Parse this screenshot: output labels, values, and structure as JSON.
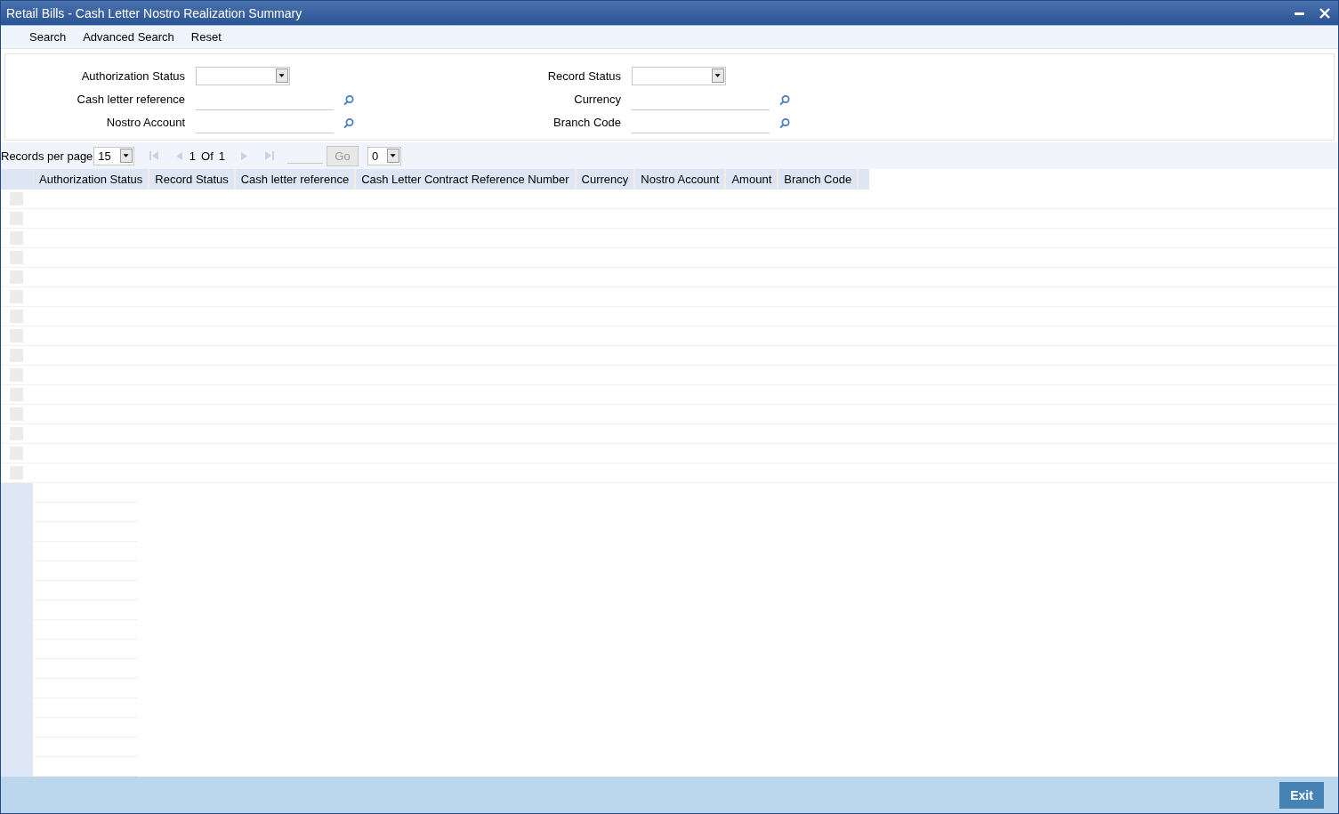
{
  "window": {
    "title": "Retail Bills - Cash Letter Nostro Realization Summary"
  },
  "menu": [
    {
      "label": "Search"
    },
    {
      "label": "Advanced Search"
    },
    {
      "label": "Reset"
    }
  ],
  "search_fields": [
    [
      {
        "label": "Authorization Status",
        "kind": "dropdown"
      },
      {
        "label": "Cash letter reference",
        "kind": "lookup"
      },
      {
        "label": "Nostro Account",
        "kind": "lookup"
      }
    ],
    [
      {
        "label": "Record Status",
        "kind": "dropdown"
      },
      {
        "label": "Currency",
        "kind": "lookup"
      },
      {
        "label": "Branch Code",
        "kind": "lookup"
      }
    ]
  ],
  "pagination": {
    "records_label": "Records per page",
    "records_per_page": "15",
    "page": "1",
    "of_label": "Of",
    "total_pages": "1",
    "go_button": "Go",
    "jump_value": "0"
  },
  "table": {
    "columns": [
      "Authorization Status",
      "Record Status",
      "Cash letter reference",
      "Cash Letter Contract Reference Number",
      "Currency",
      "Nostro Account",
      "Amount",
      "Branch Code"
    ],
    "rows": [
      {
        "checked": false
      },
      {
        "checked": false
      },
      {
        "checked": false
      },
      {
        "checked": false
      },
      {
        "checked": false
      },
      {
        "checked": false
      },
      {
        "checked": false
      },
      {
        "checked": false
      },
      {
        "checked": false
      },
      {
        "checked": false
      },
      {
        "checked": false
      },
      {
        "checked": false
      },
      {
        "checked": false
      },
      {
        "checked": false
      },
      {
        "checked": false
      }
    ]
  },
  "footer": {
    "button": "Exit"
  }
}
